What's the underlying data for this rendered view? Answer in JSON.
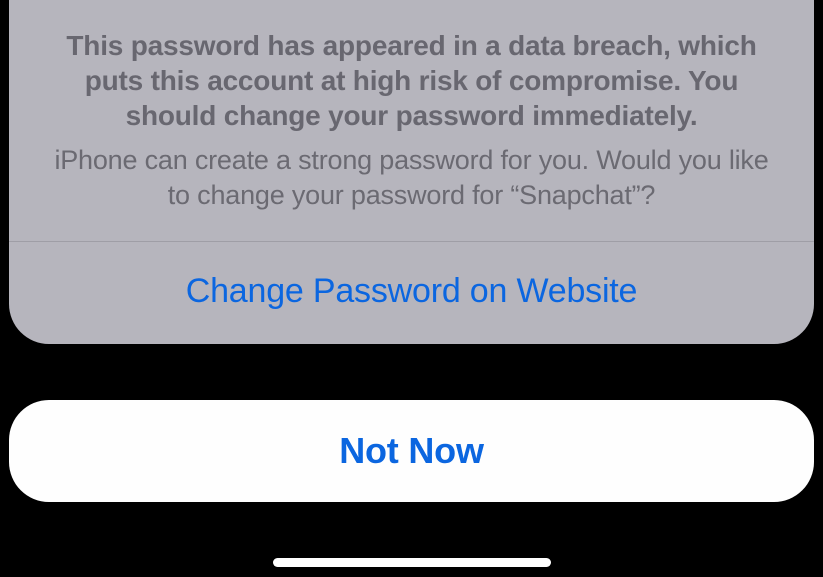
{
  "alert": {
    "title": "This password has appeared in a data breach, which puts this account at high risk of compromise. You should change your password immediately.",
    "subtitle": "iPhone can create a strong password for you. Would you like to change your password for “Snapchat”?",
    "change_label": "Change Password on Website",
    "cancel_label": "Not Now"
  }
}
